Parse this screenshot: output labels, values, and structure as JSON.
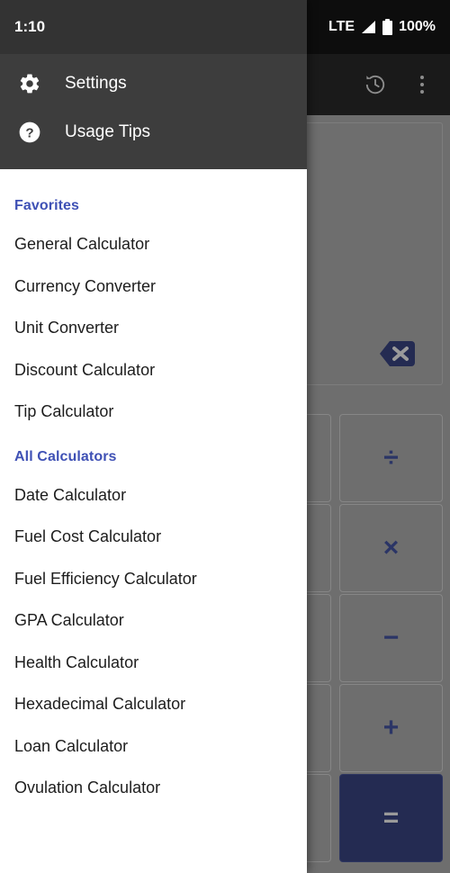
{
  "status_bar": {
    "time": "1:10",
    "network": "LTE",
    "battery_percent": "100%",
    "signal_icon": "signal-bars-icon",
    "battery_icon": "battery-full-icon"
  },
  "toolbar": {
    "history_icon": "history-icon",
    "overflow_icon": "more-vertical-icon"
  },
  "calculator": {
    "display_value": "",
    "backspace_icon": "backspace-icon",
    "keys": [
      {
        "name": "divide-key",
        "label": "÷",
        "accent": false
      },
      {
        "name": "multiply-key",
        "label": "×",
        "accent": false
      },
      {
        "name": "subtract-key",
        "label": "−",
        "accent": false
      },
      {
        "name": "add-key",
        "label": "+",
        "accent": false
      },
      {
        "name": "equals-key",
        "label": "=",
        "accent": true
      }
    ],
    "accent_color": "#242b52",
    "key_color": "#6e6e6e"
  },
  "drawer": {
    "header_items": [
      {
        "name": "drawer-settings",
        "label": "Settings",
        "icon": "gear-icon"
      },
      {
        "name": "drawer-usage-tips",
        "label": "Usage Tips",
        "icon": "help-circle-icon"
      }
    ],
    "sections": [
      {
        "name": "favorites",
        "title": "Favorites",
        "items": [
          "General Calculator",
          "Currency Converter",
          "Unit Converter",
          "Discount Calculator",
          "Tip Calculator"
        ]
      },
      {
        "name": "all-calculators",
        "title": "All Calculators",
        "items": [
          "Date Calculator",
          "Fuel Cost Calculator",
          "Fuel Efficiency Calculator",
          "GPA Calculator",
          "Health Calculator",
          "Hexadecimal Calculator",
          "Loan Calculator",
          "Ovulation Calculator"
        ]
      }
    ],
    "section_color": "#3f51b5"
  }
}
